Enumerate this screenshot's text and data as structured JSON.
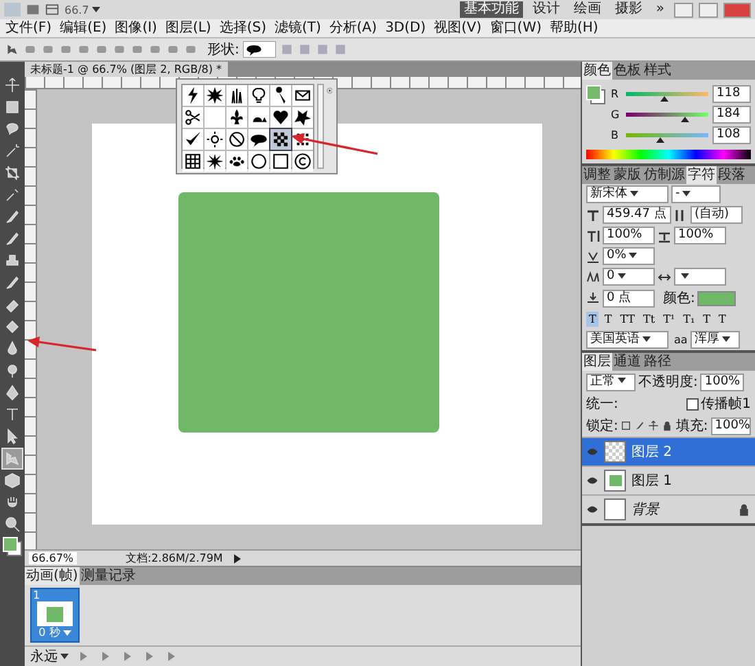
{
  "app_bar": {
    "zoom": "66.7",
    "workspaces": [
      {
        "label": "基本功能",
        "selected": true
      },
      {
        "label": "设计",
        "selected": false
      },
      {
        "label": "绘画",
        "selected": false
      },
      {
        "label": "摄影",
        "selected": false
      }
    ],
    "more": "»"
  },
  "menu": [
    "文件(F)",
    "编辑(E)",
    "图像(I)",
    "图层(L)",
    "选择(S)",
    "滤镜(T)",
    "分析(A)",
    "3D(D)",
    "视图(V)",
    "窗口(W)",
    "帮助(H)"
  ],
  "options_bar": {
    "shape_label": "形状:"
  },
  "toolbar": {
    "tools": [
      {
        "kind": "move",
        "selected": false
      },
      {
        "kind": "marquee",
        "selected": false
      },
      {
        "kind": "lasso",
        "selected": false
      },
      {
        "kind": "wand",
        "selected": false
      },
      {
        "kind": "crop",
        "selected": false
      },
      {
        "kind": "eyedropper",
        "selected": false
      },
      {
        "kind": "brush",
        "selected": false
      },
      {
        "kind": "brush",
        "selected": false
      },
      {
        "kind": "stamp",
        "selected": false
      },
      {
        "kind": "brush",
        "selected": false
      },
      {
        "kind": "eraser",
        "selected": false
      },
      {
        "kind": "bucket",
        "selected": false
      },
      {
        "kind": "drop",
        "selected": false
      },
      {
        "kind": "dodge",
        "selected": false
      },
      {
        "kind": "pen",
        "selected": false
      },
      {
        "kind": "type",
        "selected": false
      },
      {
        "kind": "arrow",
        "selected": false
      },
      {
        "kind": "shape",
        "selected": true
      },
      {
        "kind": "cube",
        "selected": false
      },
      {
        "kind": "hand",
        "selected": false
      },
      {
        "kind": "zoom",
        "selected": false
      }
    ]
  },
  "document": {
    "tab": "未标题-1 @ 66.7% (图层 2, RGB/8) *",
    "zoom": "66.67%",
    "doc_info": "文档:2.86M/2.79M"
  },
  "shape_picker": {
    "shapes": [
      {
        "kind": "bolt",
        "selected": false
      },
      {
        "kind": "burst",
        "selected": false
      },
      {
        "kind": "grass",
        "selected": false
      },
      {
        "kind": "bulb",
        "selected": false
      },
      {
        "kind": "key",
        "selected": false
      },
      {
        "kind": "envelope",
        "selected": false
      },
      {
        "kind": "scissors",
        "selected": false
      },
      {
        "kind": "blank",
        "selected": false
      },
      {
        "kind": "fleur",
        "selected": false
      },
      {
        "kind": "snail",
        "selected": false
      },
      {
        "kind": "heart",
        "selected": false
      },
      {
        "kind": "blot",
        "selected": false
      },
      {
        "kind": "check",
        "selected": false
      },
      {
        "kind": "flower",
        "selected": false
      },
      {
        "kind": "forbidden",
        "selected": false
      },
      {
        "kind": "speech",
        "selected": false
      },
      {
        "kind": "checker",
        "selected": true
      },
      {
        "kind": "dots",
        "selected": false
      },
      {
        "kind": "grid",
        "selected": false
      },
      {
        "kind": "splat",
        "selected": false
      },
      {
        "kind": "paw",
        "selected": false
      },
      {
        "kind": "circle",
        "selected": false
      },
      {
        "kind": "square",
        "selected": false
      },
      {
        "kind": "copyright",
        "selected": false
      }
    ]
  },
  "color_panel": {
    "tabs": [
      {
        "label": "颜色",
        "selected": true
      },
      {
        "label": "色板",
        "selected": false
      },
      {
        "label": "样式",
        "selected": false
      }
    ],
    "channels": [
      {
        "name": "R",
        "value": "118",
        "level": 0.463
      },
      {
        "name": "G",
        "value": "184",
        "level": 0.722
      },
      {
        "name": "B",
        "value": "108",
        "level": 0.424
      }
    ]
  },
  "character_panel": {
    "tabs": [
      {
        "label": "调整",
        "selected": false
      },
      {
        "label": "蒙版",
        "selected": false
      },
      {
        "label": "仿制源",
        "selected": false
      },
      {
        "label": "字符",
        "selected": true
      },
      {
        "label": "段落",
        "selected": false
      }
    ],
    "font": "新宋体",
    "style": "-",
    "size": "459.47 点",
    "leading": "(自动)",
    "vertical_scale": "100%",
    "horizontal_scale": "100%",
    "tracking": "0%",
    "kerning": "0",
    "baseline": "0 点",
    "color_label": "颜色:",
    "style_buttons": [
      {
        "label": "T",
        "selected": true
      },
      {
        "label": "T",
        "selected": false
      },
      {
        "label": "TT",
        "selected": false
      },
      {
        "label": "Tt",
        "selected": false
      },
      {
        "label": "T¹",
        "selected": false
      },
      {
        "label": "T₁",
        "selected": false
      },
      {
        "label": "T",
        "selected": false
      },
      {
        "label": "T",
        "selected": false
      }
    ],
    "language": "美国英语",
    "antialias_label": "aa",
    "antialias": "浑厚"
  },
  "layers_panel": {
    "tabs": [
      {
        "label": "图层",
        "selected": true
      },
      {
        "label": "通道",
        "selected": false
      },
      {
        "label": "路径",
        "selected": false
      }
    ],
    "blend": "正常",
    "opacity_label": "不透明度:",
    "opacity": "100%",
    "unify_label": "统一:",
    "propagate": "传播帧1",
    "propagate_checked": false,
    "lock_label": "锁定:",
    "fill_label": "填充:",
    "fill": "100%",
    "layers": [
      {
        "name": "图层 2",
        "kind": "transparent",
        "selected": true,
        "locked": false,
        "visible": true
      },
      {
        "name": "图层 1",
        "kind": "green",
        "selected": false,
        "locked": false,
        "visible": true
      },
      {
        "name": "背景",
        "kind": "white",
        "selected": false,
        "locked": true,
        "visible": true
      }
    ]
  },
  "animation_panel": {
    "tabs": [
      {
        "label": "动画(帧)",
        "selected": true
      },
      {
        "label": "测量记录",
        "selected": false
      }
    ],
    "frames": [
      {
        "number": "1",
        "delay": "0 秒",
        "selected": true
      }
    ],
    "loop": "永远"
  }
}
